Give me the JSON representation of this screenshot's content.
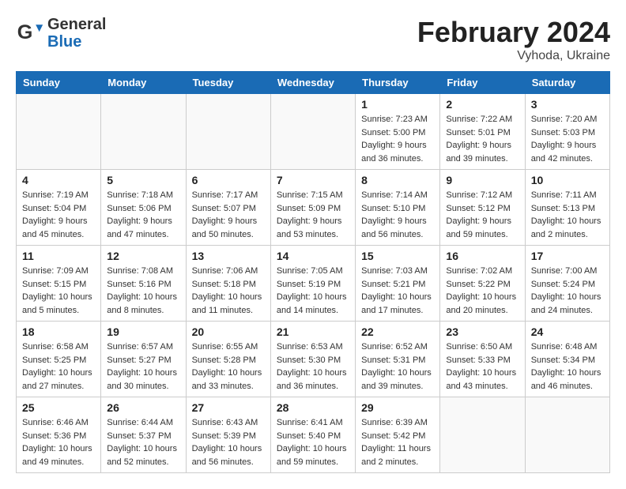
{
  "header": {
    "logo_line1": "General",
    "logo_line2": "Blue",
    "month_title": "February 2024",
    "subtitle": "Vyhoda, Ukraine"
  },
  "weekdays": [
    "Sunday",
    "Monday",
    "Tuesday",
    "Wednesday",
    "Thursday",
    "Friday",
    "Saturday"
  ],
  "weeks": [
    [
      {
        "day": "",
        "info": ""
      },
      {
        "day": "",
        "info": ""
      },
      {
        "day": "",
        "info": ""
      },
      {
        "day": "",
        "info": ""
      },
      {
        "day": "1",
        "info": "Sunrise: 7:23 AM\nSunset: 5:00 PM\nDaylight: 9 hours\nand 36 minutes."
      },
      {
        "day": "2",
        "info": "Sunrise: 7:22 AM\nSunset: 5:01 PM\nDaylight: 9 hours\nand 39 minutes."
      },
      {
        "day": "3",
        "info": "Sunrise: 7:20 AM\nSunset: 5:03 PM\nDaylight: 9 hours\nand 42 minutes."
      }
    ],
    [
      {
        "day": "4",
        "info": "Sunrise: 7:19 AM\nSunset: 5:04 PM\nDaylight: 9 hours\nand 45 minutes."
      },
      {
        "day": "5",
        "info": "Sunrise: 7:18 AM\nSunset: 5:06 PM\nDaylight: 9 hours\nand 47 minutes."
      },
      {
        "day": "6",
        "info": "Sunrise: 7:17 AM\nSunset: 5:07 PM\nDaylight: 9 hours\nand 50 minutes."
      },
      {
        "day": "7",
        "info": "Sunrise: 7:15 AM\nSunset: 5:09 PM\nDaylight: 9 hours\nand 53 minutes."
      },
      {
        "day": "8",
        "info": "Sunrise: 7:14 AM\nSunset: 5:10 PM\nDaylight: 9 hours\nand 56 minutes."
      },
      {
        "day": "9",
        "info": "Sunrise: 7:12 AM\nSunset: 5:12 PM\nDaylight: 9 hours\nand 59 minutes."
      },
      {
        "day": "10",
        "info": "Sunrise: 7:11 AM\nSunset: 5:13 PM\nDaylight: 10 hours\nand 2 minutes."
      }
    ],
    [
      {
        "day": "11",
        "info": "Sunrise: 7:09 AM\nSunset: 5:15 PM\nDaylight: 10 hours\nand 5 minutes."
      },
      {
        "day": "12",
        "info": "Sunrise: 7:08 AM\nSunset: 5:16 PM\nDaylight: 10 hours\nand 8 minutes."
      },
      {
        "day": "13",
        "info": "Sunrise: 7:06 AM\nSunset: 5:18 PM\nDaylight: 10 hours\nand 11 minutes."
      },
      {
        "day": "14",
        "info": "Sunrise: 7:05 AM\nSunset: 5:19 PM\nDaylight: 10 hours\nand 14 minutes."
      },
      {
        "day": "15",
        "info": "Sunrise: 7:03 AM\nSunset: 5:21 PM\nDaylight: 10 hours\nand 17 minutes."
      },
      {
        "day": "16",
        "info": "Sunrise: 7:02 AM\nSunset: 5:22 PM\nDaylight: 10 hours\nand 20 minutes."
      },
      {
        "day": "17",
        "info": "Sunrise: 7:00 AM\nSunset: 5:24 PM\nDaylight: 10 hours\nand 24 minutes."
      }
    ],
    [
      {
        "day": "18",
        "info": "Sunrise: 6:58 AM\nSunset: 5:25 PM\nDaylight: 10 hours\nand 27 minutes."
      },
      {
        "day": "19",
        "info": "Sunrise: 6:57 AM\nSunset: 5:27 PM\nDaylight: 10 hours\nand 30 minutes."
      },
      {
        "day": "20",
        "info": "Sunrise: 6:55 AM\nSunset: 5:28 PM\nDaylight: 10 hours\nand 33 minutes."
      },
      {
        "day": "21",
        "info": "Sunrise: 6:53 AM\nSunset: 5:30 PM\nDaylight: 10 hours\nand 36 minutes."
      },
      {
        "day": "22",
        "info": "Sunrise: 6:52 AM\nSunset: 5:31 PM\nDaylight: 10 hours\nand 39 minutes."
      },
      {
        "day": "23",
        "info": "Sunrise: 6:50 AM\nSunset: 5:33 PM\nDaylight: 10 hours\nand 43 minutes."
      },
      {
        "day": "24",
        "info": "Sunrise: 6:48 AM\nSunset: 5:34 PM\nDaylight: 10 hours\nand 46 minutes."
      }
    ],
    [
      {
        "day": "25",
        "info": "Sunrise: 6:46 AM\nSunset: 5:36 PM\nDaylight: 10 hours\nand 49 minutes."
      },
      {
        "day": "26",
        "info": "Sunrise: 6:44 AM\nSunset: 5:37 PM\nDaylight: 10 hours\nand 52 minutes."
      },
      {
        "day": "27",
        "info": "Sunrise: 6:43 AM\nSunset: 5:39 PM\nDaylight: 10 hours\nand 56 minutes."
      },
      {
        "day": "28",
        "info": "Sunrise: 6:41 AM\nSunset: 5:40 PM\nDaylight: 10 hours\nand 59 minutes."
      },
      {
        "day": "29",
        "info": "Sunrise: 6:39 AM\nSunset: 5:42 PM\nDaylight: 11 hours\nand 2 minutes."
      },
      {
        "day": "",
        "info": ""
      },
      {
        "day": "",
        "info": ""
      }
    ]
  ]
}
